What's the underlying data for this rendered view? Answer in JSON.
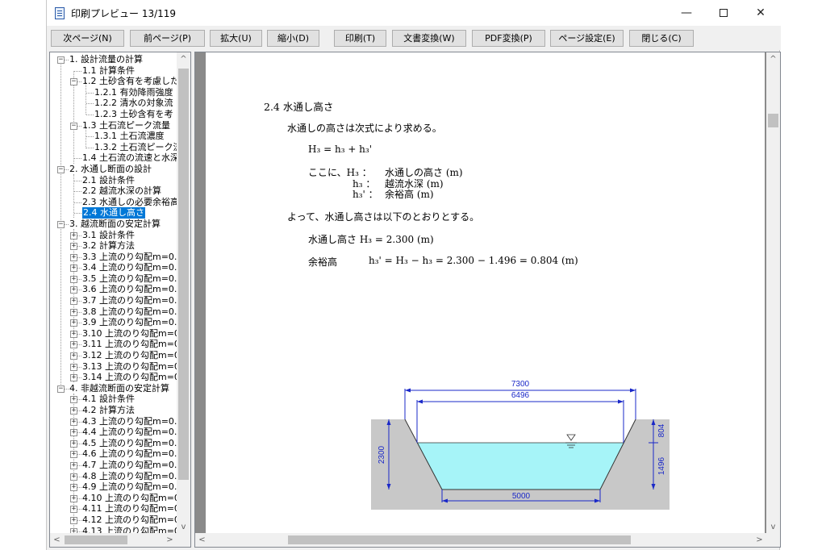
{
  "window": {
    "title": "印刷プレビュー 13/119",
    "minimize": "—",
    "close": "✕"
  },
  "toolbar": {
    "buttons": [
      "次ページ(N)",
      "前ページ(P)",
      "拡大(U)",
      "縮小(D)",
      "印刷(T)",
      "文書変換(W)",
      "PDF変換(P)",
      "ページ設定(E)",
      "閉じる(C)"
    ]
  },
  "tree": {
    "nodes": [
      "1. 設計流量の計算",
      "1.1 計算条件",
      "1.2 土砂含有を考慮した",
      "1.2.1 有効降雨強度",
      "1.2.2 清水の対象流",
      "1.2.3 土砂含有を考",
      "1.3 土石流ピーク流量",
      "1.3.1 土石流濃度",
      "1.3.2 土石流ピーク流",
      "1.4 土石流の流速と水深",
      "2. 水通し断面の設計",
      "2.1 設計条件",
      "2.2 越流水深の計算",
      "2.3 水通しの必要余裕高",
      "2.4 水通し高さ",
      "3. 越流断面の安定計算",
      "3.1 設計条件",
      "3.2 計算方法",
      "3.3 上流のり勾配m=0.2",
      "3.4 上流のり勾配m=0.2",
      "3.5 上流のり勾配m=0.3",
      "3.6 上流のり勾配m=0.3",
      "3.7 上流のり勾配m=0.3",
      "3.8 上流のり勾配m=0.3",
      "3.9 上流のり勾配m=0.2",
      "3.10 上流のり勾配m=0.",
      "3.11 上流のり勾配m=0.",
      "3.12 上流のり勾配m=0.",
      "3.13 上流のり勾配m=0.",
      "3.14 上流のり勾配m=0.",
      "4. 非越流断面の安定計算",
      "4.1 設計条件",
      "4.2 計算方法",
      "4.3 上流のり勾配m=0.2",
      "4.4 上流のり勾配m=0.2",
      "4.5 上流のり勾配m=0.3",
      "4.6 上流のり勾配m=0.3",
      "4.7 上流のり勾配m=0.3",
      "4.8 上流のり勾配m=0.3",
      "4.9 上流のり勾配m=0.2",
      "4.10 上流のり勾配m=0.",
      "4.11 上流のり勾配m=0.",
      "4.12 上流のり勾配m=0.",
      "4.13 上流のり勾配m=0"
    ],
    "selected": "2.4 水通し高さ"
  },
  "document": {
    "heading": "2.4  水通し高さ",
    "intro": "水通しの高さは次式により求める。",
    "formula": "H₃ = h₃ + h₃'",
    "where_prefix": "ここに、H₃  ：",
    "where_H3": "水通しの高さ (m)",
    "where_h3_sym": "h₃  ：",
    "where_h3": "越流水深 (m)",
    "where_h3p_sym": "h₃' ：",
    "where_h3p": "余裕高 (m)",
    "conclusion": "よって、水通し高さは以下のとおりとする。",
    "result_label": "水通し高さ H₃ = 2.300 (m)",
    "margin_label": "余裕高",
    "margin_formula": "h₃' = H₃ − h₃ = 2.300 − 1.496 = 0.804 (m)"
  },
  "diagram": {
    "dim_top_outer": "7300",
    "dim_top_inner": "6496",
    "dim_bottom": "5000",
    "dim_height": "2300",
    "dim_freeboard": "804",
    "dim_depth": "1496",
    "water_color": "#a6f4f8",
    "concrete_color": "#c8c8c8",
    "dim_color": "#1a28c8"
  },
  "scroll_arrows": {
    "up": "^",
    "down": "v",
    "left": "<",
    "right": ">"
  }
}
